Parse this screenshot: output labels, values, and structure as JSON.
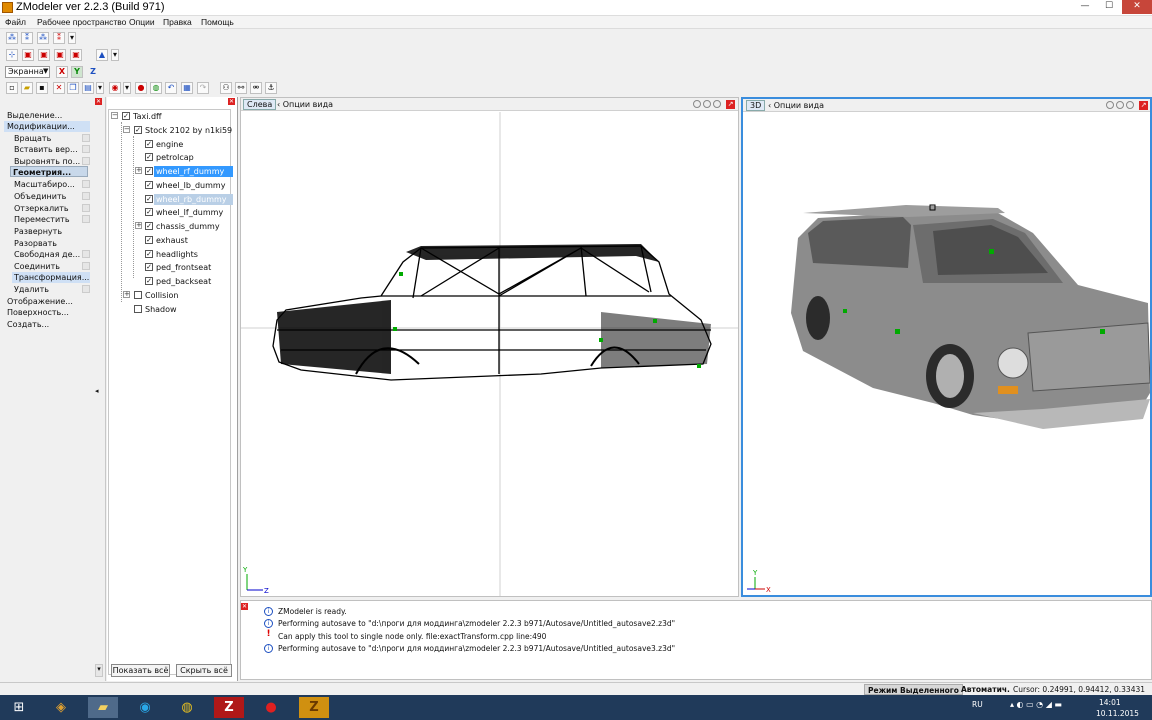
{
  "window": {
    "title": "ZModeler ver 2.2.3 (Build 971)",
    "min_label": "—",
    "max_label": "☐",
    "close_label": "✕"
  },
  "menu": [
    "Файл",
    "Рабочее пространство",
    "Опции",
    "Правка",
    "Помощь"
  ],
  "toolbar": {
    "view_select": "Экраннa",
    "axis_x": "X",
    "axis_y": "Y",
    "axis_z": "Z"
  },
  "commands": {
    "items": [
      "Выделение...",
      "Модификации...",
      "Вращать",
      "Вставить вер...",
      "Выровнять по...",
      "Геометрия...",
      "Масштабиро...",
      "Объединить",
      "Отзеркалить",
      "Переместить",
      "Развернуть",
      "Разорвать",
      "Свободная де...",
      "Соединить",
      "Трансформация...",
      "Удалить",
      "Отображение...",
      "Поверхность...",
      "Создать..."
    ]
  },
  "tree": {
    "nodes": [
      "Taxi.dff",
      "Stock 2102 by n1ki59",
      "engine",
      "petrolcap",
      "wheel_rf_dummy",
      "wheel_lb_dummy",
      "wheel_rb_dummy",
      "wheel_lf_dummy",
      "chassis_dummy",
      "exhaust",
      "headlights",
      "ped_frontseat",
      "ped_backseat",
      "Collision",
      "Shadow"
    ],
    "show_all": "Показать всё",
    "hide_all": "Скрыть всё"
  },
  "viewports": {
    "left": {
      "tab": "Слева",
      "options": "Опции вида"
    },
    "three_d": {
      "tab": "3D",
      "options": "Опции вида"
    }
  },
  "log": [
    {
      "type": "info",
      "text": "ZModeler is ready."
    },
    {
      "type": "info",
      "text": "Performing autosave to \"d:\\проги для моддинга\\zmodeler 2.2.3 b971/Autosave/Untitled_autosave2.z3d\""
    },
    {
      "type": "error",
      "text": "Can apply this tool to single node only. file:exactTransform.cpp line:490"
    },
    {
      "type": "info",
      "text": "Performing autosave to \"d:\\проги для моддинга\\zmodeler 2.2.3 b971/Autosave/Untitled_autosave3.z3d\""
    }
  ],
  "status": {
    "mode": "Режим Выделенного",
    "auto": "Автоматич.",
    "cursor": "Cursor: 0.24991, 0.94412, 0.33431"
  },
  "taskbar": {
    "lang": "RU",
    "time": "14:01",
    "date": "10.11.2015"
  },
  "axis_labels": {
    "y": "Y",
    "z": "Z",
    "x": "X"
  }
}
